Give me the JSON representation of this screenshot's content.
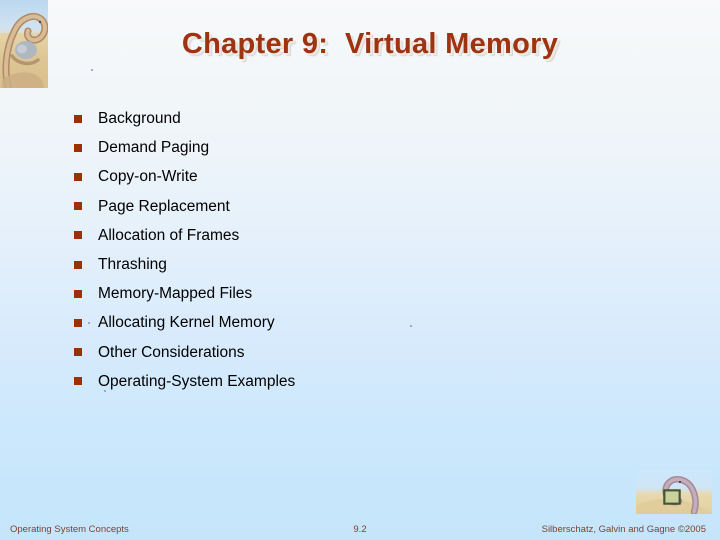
{
  "slide": {
    "title": "Chapter 9:  Virtual Memory",
    "bullets": [
      {
        "label": "Background"
      },
      {
        "label": "Demand Paging"
      },
      {
        "label": "Copy-on-Write"
      },
      {
        "label": "Page Replacement"
      },
      {
        "label": "Allocation of Frames"
      },
      {
        "label": "Thrashing"
      },
      {
        "label": "Memory-Mapped Files"
      },
      {
        "label": "Allocating Kernel Memory"
      },
      {
        "label": "Other Considerations"
      },
      {
        "label": "Operating-System Examples"
      }
    ],
    "footer": {
      "left": "Operating System Concepts",
      "center": "9.2",
      "right": "Silberschatz, Galvin and Gagne ©2005"
    },
    "images": {
      "top_left": "dinosaur-cover-illustration",
      "bottom_right": "dinosaur-with-book-illustration"
    },
    "colors": {
      "title": "#9e3311",
      "bullet_marker": "#9b3005",
      "body_text": "#000000",
      "footer_text": "#7c4332",
      "background_top": "#f7f9fa",
      "background_bottom": "#c5e5fb"
    }
  }
}
